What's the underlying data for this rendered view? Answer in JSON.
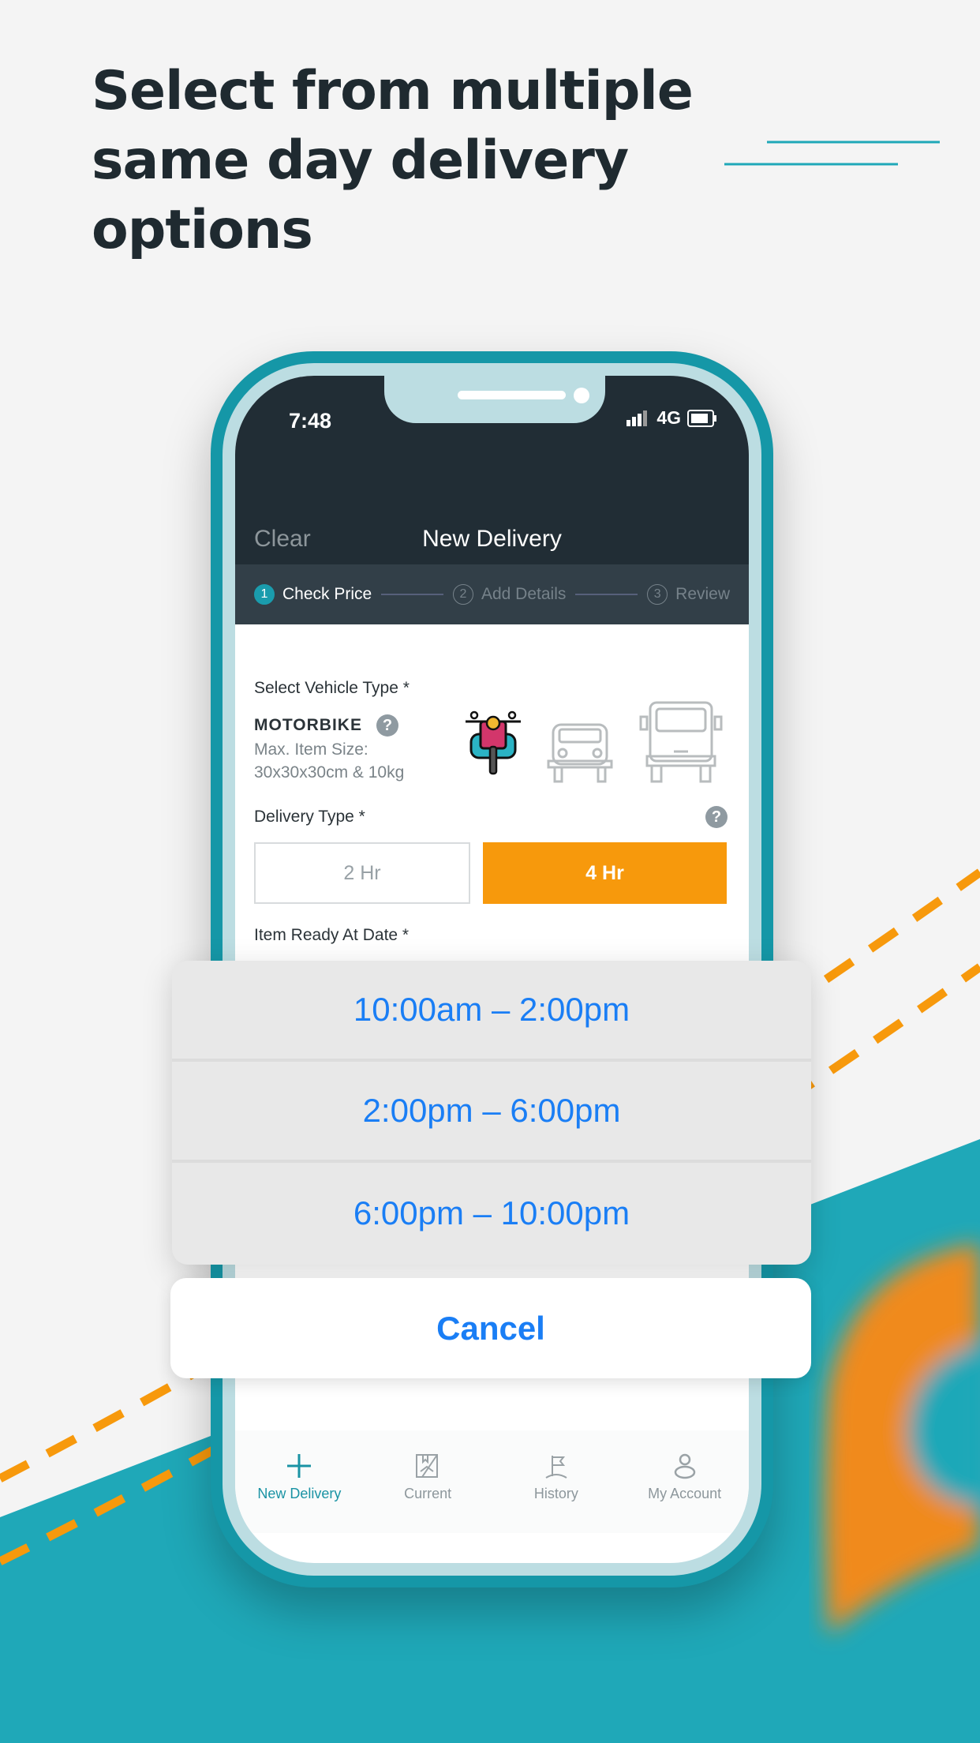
{
  "headline": [
    "Select from multiple",
    "same day delivery",
    "options"
  ],
  "colors": {
    "teal": "#1fa8b8",
    "orange": "#f7990c",
    "dark": "#212d35",
    "ios_blue": "#1a7ef5"
  },
  "status_bar": {
    "time": "7:48",
    "network": "4G"
  },
  "nav": {
    "clear": "Clear",
    "title": "New Delivery"
  },
  "steps": [
    {
      "num": "1",
      "label": "Check Price",
      "active": true
    },
    {
      "num": "2",
      "label": "Add Details"
    },
    {
      "num": "3",
      "label": "Review"
    }
  ],
  "form": {
    "vehicle_label": "Select Vehicle Type *",
    "vehicle_name": "MOTORBIKE",
    "size_line1": "Max. Item Size:",
    "size_line2": "30x30x30cm & 10kg",
    "vehicles": [
      "motorbike-icon",
      "car-icon",
      "van-icon"
    ],
    "delivery_label": "Delivery Type *",
    "delivery_options": [
      "2 Hr",
      "4 Hr"
    ],
    "delivery_selected": "4 Hr",
    "ready_label": "Item Ready At Date *"
  },
  "action_sheet": {
    "options": [
      "10:00am – 2:00pm",
      "2:00pm – 6:00pm",
      "6:00pm – 10:00pm"
    ],
    "cancel": "Cancel"
  },
  "tabbar": [
    {
      "label": "New Delivery",
      "icon": "plus-icon",
      "active": true
    },
    {
      "label": "Current",
      "icon": "package-hand-icon"
    },
    {
      "label": "History",
      "icon": "flag-icon"
    },
    {
      "label": "My Account",
      "icon": "user-icon"
    }
  ]
}
